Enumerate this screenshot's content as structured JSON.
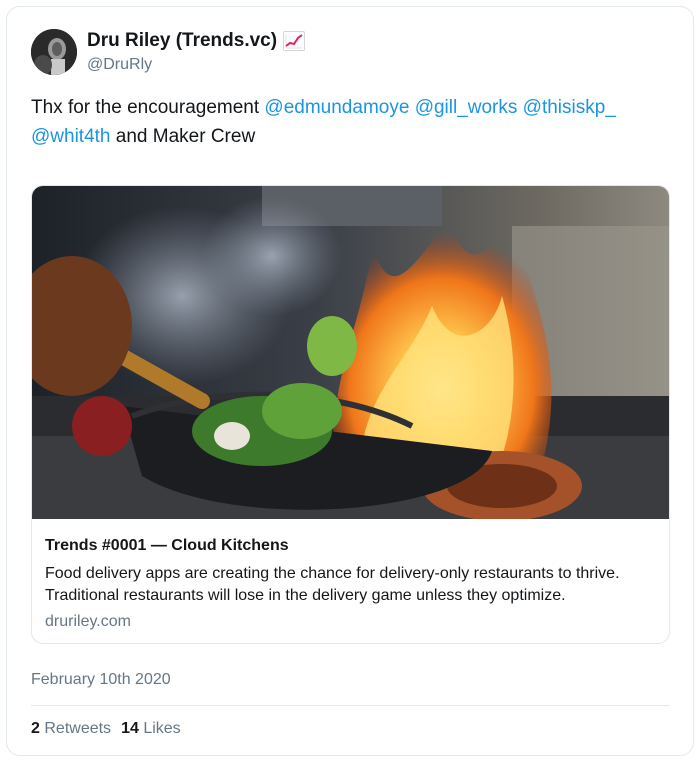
{
  "author": {
    "display_name": "Dru Riley (Trends.vc)",
    "handle": "@DruRly",
    "name_emoji_icon": "chart-increasing-icon"
  },
  "tweet": {
    "text_prefix": "Thx for the encouragement ",
    "mentions": [
      "@edmundamoye",
      "@gill_works",
      "@thisiskp_",
      "@whit4th"
    ],
    "text_suffix": " and Maker Crew"
  },
  "card": {
    "image": "wok-with-flames-photo",
    "title": "Trends #0001 — Cloud Kitchens",
    "description": "Food delivery apps are creating the chance for delivery-only restaurants to thrive. Traditional restaurants will lose in the delivery game unless they optimize.",
    "domain": "druriley.com"
  },
  "date": "February 10th 2020",
  "stats": {
    "retweets_count": "2",
    "retweets_label": "Retweets",
    "likes_count": "14",
    "likes_label": "Likes"
  },
  "colors": {
    "mention": "#1b95e0",
    "secondary_text": "#657786",
    "border": "#e1e8ed"
  }
}
